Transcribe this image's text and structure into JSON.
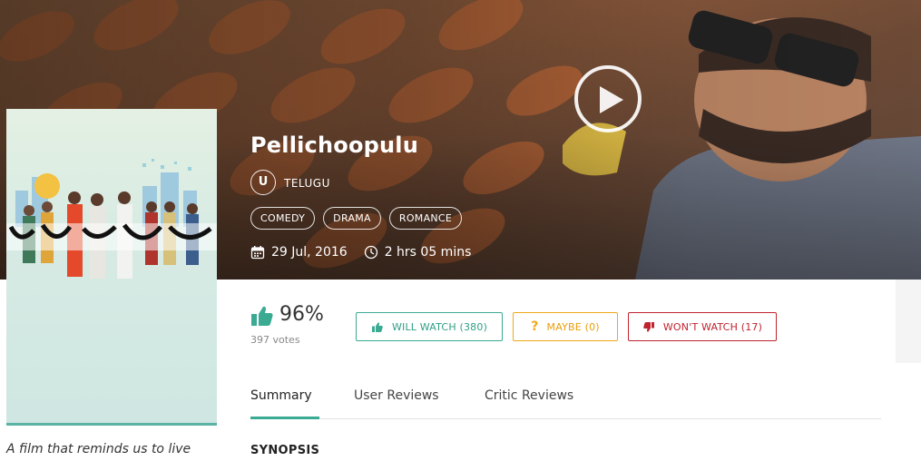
{
  "movie": {
    "title": "Pellichoopulu",
    "language_badge": "U",
    "language": "TELUGU",
    "genres": [
      "COMEDY",
      "DRAMA",
      "ROMANCE"
    ],
    "release_date": "29 Jul, 2016",
    "duration": "2 hrs 05 mins",
    "tagline": "A film that reminds us to live"
  },
  "rating": {
    "percent": "96%",
    "votes": "397 votes"
  },
  "actions": {
    "will_watch": "WILL WATCH (380)",
    "maybe": "MAYBE (0)",
    "wont_watch": "WON'T WATCH (17)"
  },
  "tabs": [
    "Summary",
    "User Reviews",
    "Critic Reviews"
  ],
  "section": {
    "synopsis_heading": "SYNOPSIS"
  },
  "colors": {
    "accent_green": "#3aaa92",
    "maybe_orange": "#f0a818",
    "wont_red": "#c0222e"
  },
  "icons": {
    "play": "play-icon",
    "like": "thumbs-up-icon",
    "calendar": "calendar-icon",
    "clock": "clock-icon",
    "dislike": "thumbs-down-icon",
    "question": "question-icon"
  }
}
